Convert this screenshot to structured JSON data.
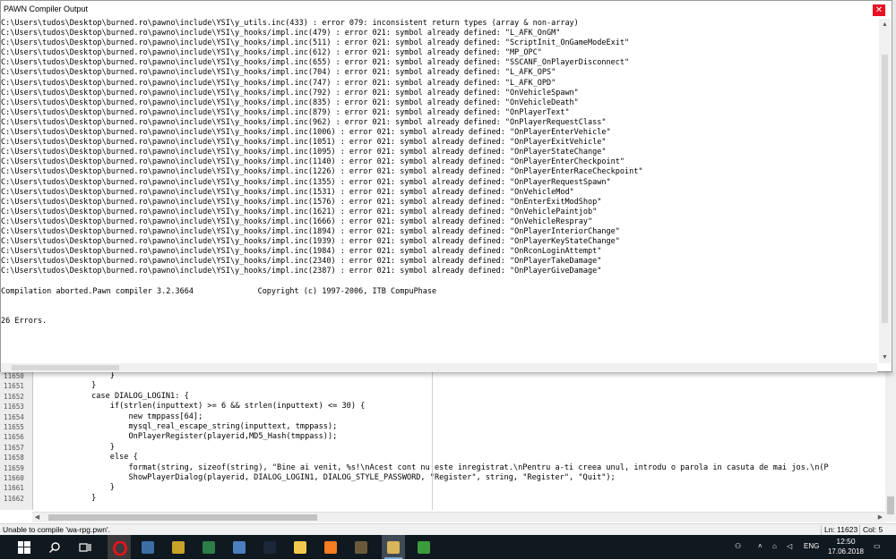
{
  "dialog": {
    "title": "PAWN Compiler Output",
    "close_glyph": "✕",
    "output_lines": [
      "C:\\Users\\tudos\\Desktop\\burned.ro\\pawno\\include\\YSI\\y_utils.inc(433) : error 079: inconsistent return types (array & non-array)",
      "C:\\Users\\tudos\\Desktop\\burned.ro\\pawno\\include\\YSI\\y_hooks/impl.inc(479) : error 021: symbol already defined: \"L_AFK_OnGM\"",
      "C:\\Users\\tudos\\Desktop\\burned.ro\\pawno\\include\\YSI\\y_hooks/impl.inc(511) : error 021: symbol already defined: \"ScriptInit_OnGameModeExit\"",
      "C:\\Users\\tudos\\Desktop\\burned.ro\\pawno\\include\\YSI\\y_hooks/impl.inc(612) : error 021: symbol already defined: \"MP_OPC\"",
      "C:\\Users\\tudos\\Desktop\\burned.ro\\pawno\\include\\YSI\\y_hooks/impl.inc(655) : error 021: symbol already defined: \"SSCANF_OnPlayerDisconnect\"",
      "C:\\Users\\tudos\\Desktop\\burned.ro\\pawno\\include\\YSI\\y_hooks/impl.inc(704) : error 021: symbol already defined: \"L_AFK_OPS\"",
      "C:\\Users\\tudos\\Desktop\\burned.ro\\pawno\\include\\YSI\\y_hooks/impl.inc(747) : error 021: symbol already defined: \"L_AFK_OPD\"",
      "C:\\Users\\tudos\\Desktop\\burned.ro\\pawno\\include\\YSI\\y_hooks/impl.inc(792) : error 021: symbol already defined: \"OnVehicleSpawn\"",
      "C:\\Users\\tudos\\Desktop\\burned.ro\\pawno\\include\\YSI\\y_hooks/impl.inc(835) : error 021: symbol already defined: \"OnVehicleDeath\"",
      "C:\\Users\\tudos\\Desktop\\burned.ro\\pawno\\include\\YSI\\y_hooks/impl.inc(879) : error 021: symbol already defined: \"OnPlayerText\"",
      "C:\\Users\\tudos\\Desktop\\burned.ro\\pawno\\include\\YSI\\y_hooks/impl.inc(962) : error 021: symbol already defined: \"OnPlayerRequestClass\"",
      "C:\\Users\\tudos\\Desktop\\burned.ro\\pawno\\include\\YSI\\y_hooks/impl.inc(1006) : error 021: symbol already defined: \"OnPlayerEnterVehicle\"",
      "C:\\Users\\tudos\\Desktop\\burned.ro\\pawno\\include\\YSI\\y_hooks/impl.inc(1051) : error 021: symbol already defined: \"OnPlayerExitVehicle\"",
      "C:\\Users\\tudos\\Desktop\\burned.ro\\pawno\\include\\YSI\\y_hooks/impl.inc(1095) : error 021: symbol already defined: \"OnPlayerStateChange\"",
      "C:\\Users\\tudos\\Desktop\\burned.ro\\pawno\\include\\YSI\\y_hooks/impl.inc(1140) : error 021: symbol already defined: \"OnPlayerEnterCheckpoint\"",
      "C:\\Users\\tudos\\Desktop\\burned.ro\\pawno\\include\\YSI\\y_hooks/impl.inc(1226) : error 021: symbol already defined: \"OnPlayerEnterRaceCheckpoint\"",
      "C:\\Users\\tudos\\Desktop\\burned.ro\\pawno\\include\\YSI\\y_hooks/impl.inc(1355) : error 021: symbol already defined: \"OnPlayerRequestSpawn\"",
      "C:\\Users\\tudos\\Desktop\\burned.ro\\pawno\\include\\YSI\\y_hooks/impl.inc(1531) : error 021: symbol already defined: \"OnVehicleMod\"",
      "C:\\Users\\tudos\\Desktop\\burned.ro\\pawno\\include\\YSI\\y_hooks/impl.inc(1576) : error 021: symbol already defined: \"OnEnterExitModShop\"",
      "C:\\Users\\tudos\\Desktop\\burned.ro\\pawno\\include\\YSI\\y_hooks/impl.inc(1621) : error 021: symbol already defined: \"OnVehiclePaintjob\"",
      "C:\\Users\\tudos\\Desktop\\burned.ro\\pawno\\include\\YSI\\y_hooks/impl.inc(1666) : error 021: symbol already defined: \"OnVehicleRespray\"",
      "C:\\Users\\tudos\\Desktop\\burned.ro\\pawno\\include\\YSI\\y_hooks/impl.inc(1894) : error 021: symbol already defined: \"OnPlayerInteriorChange\"",
      "C:\\Users\\tudos\\Desktop\\burned.ro\\pawno\\include\\YSI\\y_hooks/impl.inc(1939) : error 021: symbol already defined: \"OnPlayerKeyStateChange\"",
      "C:\\Users\\tudos\\Desktop\\burned.ro\\pawno\\include\\YSI\\y_hooks/impl.inc(1984) : error 021: symbol already defined: \"OnRconLoginAttempt\"",
      "C:\\Users\\tudos\\Desktop\\burned.ro\\pawno\\include\\YSI\\y_hooks/impl.inc(2340) : error 021: symbol already defined: \"OnPlayerTakeDamage\"",
      "C:\\Users\\tudos\\Desktop\\burned.ro\\pawno\\include\\YSI\\y_hooks/impl.inc(2387) : error 021: symbol already defined: \"OnPlayerGiveDamage\""
    ],
    "abort_line": "Compilation aborted.Pawn compiler 3.2.3664              Copyright (c) 1997-2006, ITB CompuPhase",
    "summary_line": "26 Errors."
  },
  "editor": {
    "line_numbers": [
      "11650",
      "11651",
      "11652",
      "11653",
      "11654",
      "11655",
      "11656",
      "11657",
      "11658",
      "11659",
      "11660",
      "11661",
      "11662"
    ],
    "code_lines": [
      "                }",
      "            }",
      "            case DIALOG_LOGIN1: {",
      "                if(strlen(inputtext) >= 6 && strlen(inputtext) <= 30) {",
      "                    new tmppass[64];",
      "                    mysql_real_escape_string(inputtext, tmppass);",
      "                    OnPlayerRegister(playerid,MD5_Hash(tmppass));",
      "                }",
      "                else {",
      "                    format(string, sizeof(string), \"Bine ai venit, %s!\\nAcest cont nu este inregistrat.\\nPentru a-ti creea unul, introdu o parola in casuta de mai jos.\\n(P",
      "                    ShowPlayerDialog(playerid, DIALOG_LOGIN1, DIALOG_STYLE_PASSWORD, \"Register\", string, \"Register\", \"Quit\");",
      "                }",
      "            }"
    ]
  },
  "statusbar": {
    "message": "Unable to compile 'wa-rpg.pwn'.",
    "line": "Ln: 11623",
    "col": "Col: 5"
  },
  "taskbar": {
    "apps": [
      {
        "name": "start-icon",
        "color": "#ffffff"
      },
      {
        "name": "search-icon",
        "color": "#ffffff"
      },
      {
        "name": "task-view-icon",
        "color": "#ffffff"
      },
      {
        "name": "opera-icon",
        "color": "#e0141e"
      },
      {
        "name": "app-icon",
        "color": "#3a6ea5"
      },
      {
        "name": "app-icon",
        "color": "#c8a228"
      },
      {
        "name": "app-icon",
        "color": "#2d7d46"
      },
      {
        "name": "app-icon",
        "color": "#4a7fc0"
      },
      {
        "name": "steam-icon",
        "color": "#1b2838"
      },
      {
        "name": "folder-icon",
        "color": "#f2c94c"
      },
      {
        "name": "xampp-icon",
        "color": "#f57c20"
      },
      {
        "name": "app-icon",
        "color": "#6b5a3a"
      },
      {
        "name": "pawno-icon",
        "color": "#d8b45a"
      },
      {
        "name": "app-icon",
        "color": "#3c9c3c"
      }
    ],
    "language": "ENG",
    "time": "12:50",
    "date": "17.06.2018"
  }
}
